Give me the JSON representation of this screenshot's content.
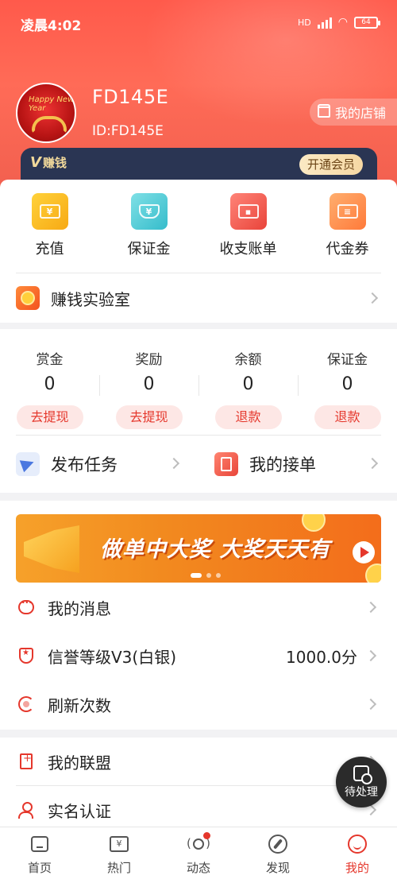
{
  "status_bar": {
    "time": "凌晨4:02",
    "network": "HD",
    "battery": "64"
  },
  "profile": {
    "name": "FD145E",
    "id_text": "ID:FD145E",
    "avatar_text": "Happy New Year",
    "shop_label": "我的店铺"
  },
  "vip": {
    "logo_v": "V",
    "logo_text": "赚钱",
    "open_label": "开通会员"
  },
  "quick_actions": [
    {
      "label": "充值",
      "icon": "recharge-icon",
      "color": "#f7b51a"
    },
    {
      "label": "保证金",
      "icon": "deposit-shield-icon",
      "color": "#43c4cf"
    },
    {
      "label": "收支账单",
      "icon": "wallet-icon",
      "color": "#f05a4f"
    },
    {
      "label": "代金券",
      "icon": "voucher-icon",
      "color": "#ff8a4a"
    }
  ],
  "lab": {
    "label": "赚钱实验室"
  },
  "balances": [
    {
      "title": "赏金",
      "value": "0",
      "action": "去提现"
    },
    {
      "title": "奖励",
      "value": "0",
      "action": "去提现"
    },
    {
      "title": "余额",
      "value": "0",
      "action": "退款"
    },
    {
      "title": "保证金",
      "value": "0",
      "action": "退款"
    }
  ],
  "tasks": {
    "publish_label": "发布任务",
    "orders_label": "我的接单"
  },
  "banner": {
    "text": "做单中大奖 大奖天天有"
  },
  "menu": [
    {
      "label": "我的消息",
      "value": ""
    },
    {
      "label": "信誉等级V3(白银)",
      "value": "1000.0分"
    },
    {
      "label": "刷新次数",
      "value": ""
    },
    {
      "label": "我的联盟",
      "value": ""
    },
    {
      "label": "实名认证",
      "value": ""
    }
  ],
  "pending": {
    "label": "待处理"
  },
  "tabbar": [
    {
      "label": "首页",
      "icon": "home-icon"
    },
    {
      "label": "热门",
      "icon": "hot-icon"
    },
    {
      "label": "动态",
      "icon": "live-icon"
    },
    {
      "label": "发现",
      "icon": "compass-icon"
    },
    {
      "label": "我的",
      "icon": "me-icon"
    }
  ],
  "colors": {
    "brand_red": "#e5372c",
    "header_red": "#ff5a4b",
    "vip_navy": "#2a3553"
  }
}
